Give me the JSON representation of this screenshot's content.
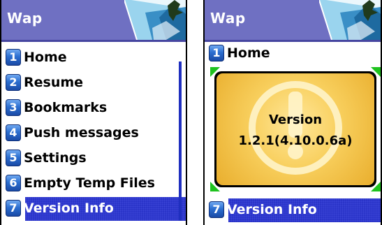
{
  "left_screen": {
    "header": {
      "title": "Wap"
    },
    "menu": [
      {
        "number": "1",
        "label": "Home"
      },
      {
        "number": "2",
        "label": "Resume"
      },
      {
        "number": "3",
        "label": "Bookmarks"
      },
      {
        "number": "4",
        "label": "Push messages"
      },
      {
        "number": "5",
        "label": "Settings"
      },
      {
        "number": "6",
        "label": "Empty Temp Files"
      },
      {
        "number": "7",
        "label": "Version Info"
      }
    ],
    "selected_index": 6
  },
  "right_screen": {
    "header": {
      "title": "Wap"
    },
    "menu_top": {
      "number": "1",
      "label": "Home"
    },
    "menu_bottom": {
      "number": "7",
      "label": "Version Info"
    },
    "popup": {
      "title": "Version",
      "value": "1.2.1(4.10.0.6a)",
      "icon": "exclamation-icon"
    }
  },
  "colors": {
    "header_bg": "#6f70c2",
    "selection_bg": "#2a34c9",
    "popup_bg": "#f8cf5d",
    "accent_green": "#1ec21e"
  }
}
